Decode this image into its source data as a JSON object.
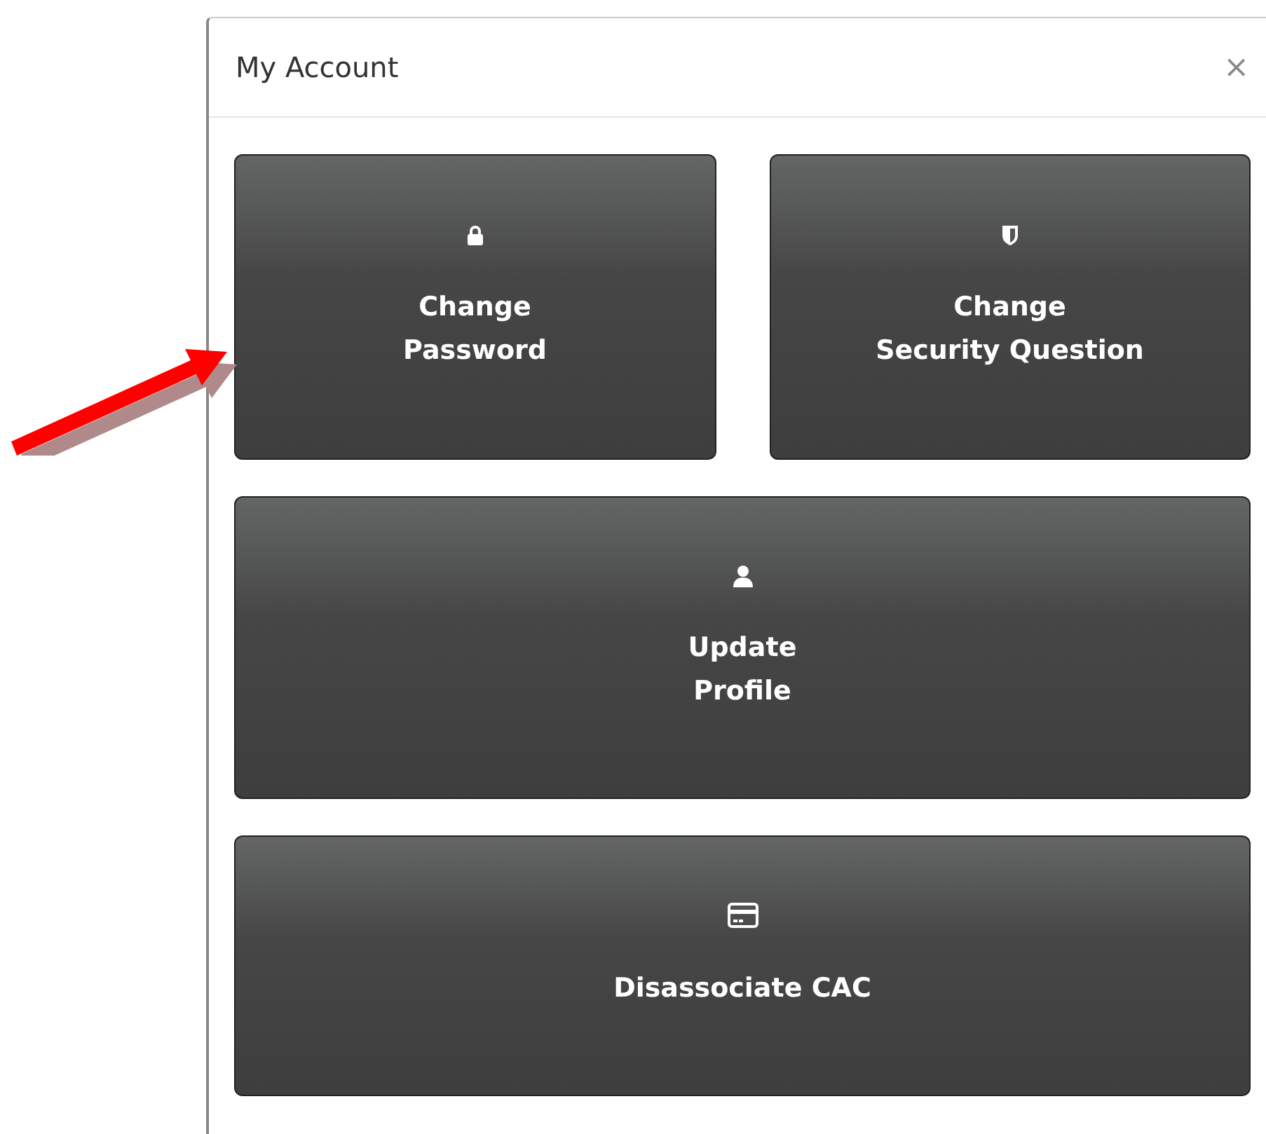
{
  "modal": {
    "title": "My Account",
    "close": "×"
  },
  "rows": [
    [
      {
        "kind": "password",
        "lines": [
          "Change",
          "Password"
        ]
      },
      {
        "kind": "security",
        "lines": [
          "Change",
          "Security Question"
        ]
      }
    ],
    [
      {
        "kind": "profile",
        "lines": [
          "Update",
          "Profile"
        ]
      }
    ],
    [
      {
        "kind": "cac",
        "lines": [
          "Disassociate CAC"
        ]
      }
    ]
  ]
}
